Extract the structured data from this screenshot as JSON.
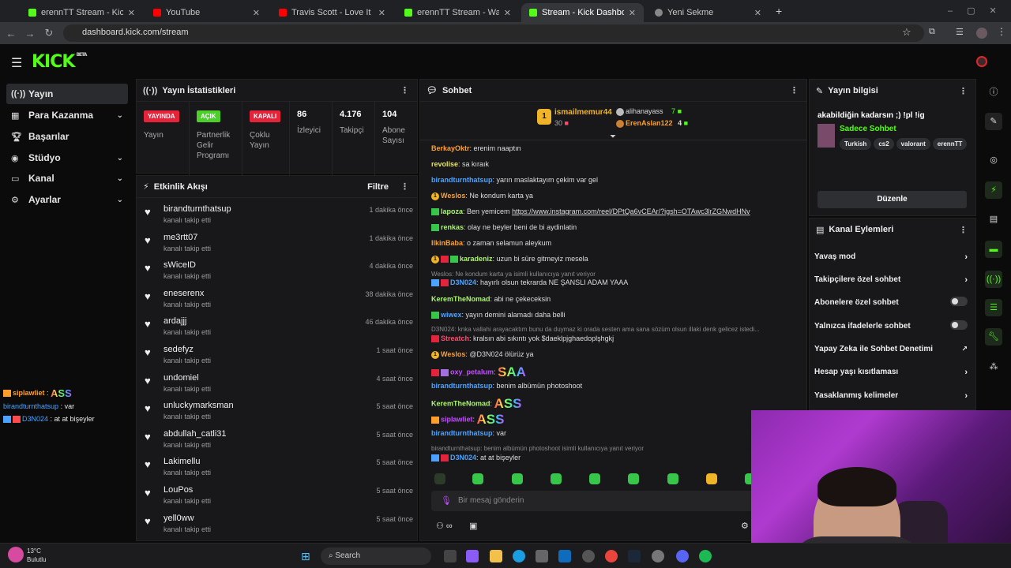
{
  "browser": {
    "tabs": [
      {
        "title": "erennTT Stream - Kick Dashboard",
        "color": "#53fc18"
      },
      {
        "title": "YouTube",
        "color": "#ff0000"
      },
      {
        "title": "Travis Scott - Love It Mane - Yo",
        "color": "#ff0000"
      },
      {
        "title": "erennTT Stream - Watch Live on",
        "color": "#53fc18"
      },
      {
        "title": "Stream - Kick Dashboard",
        "color": "#53fc18"
      },
      {
        "title": "Yeni Sekme",
        "color": "#888888"
      }
    ],
    "url": "dashboard.kick.com/stream"
  },
  "app": {
    "logo": "KICK",
    "beta": "BETA",
    "accent": "#53fc18"
  },
  "sidebar": {
    "items": [
      {
        "label": "Yayın",
        "icon": "broadcast-icon"
      },
      {
        "label": "Para Kazanma",
        "icon": "money-icon"
      },
      {
        "label": "Başarılar",
        "icon": "trophy-icon"
      },
      {
        "label": "Stüdyo",
        "icon": "studio-icon"
      },
      {
        "label": "Kanal",
        "icon": "channel-icon"
      },
      {
        "label": "Ayarlar",
        "icon": "gear-icon"
      }
    ],
    "mini_chat": [
      {
        "user": "siplawliet",
        "text": "ASS",
        "color": "#ff9f2b"
      },
      {
        "user": "birandturnthatsup",
        "text": "var",
        "color": "#4ba3ff"
      },
      {
        "user": "D3N024",
        "text": "at at bişeyler",
        "color": "#4ba3ff"
      }
    ]
  },
  "stats": {
    "title": "Yayın İstatistikleri",
    "status_badge": "YAYINDA",
    "status_label": "Yayın",
    "partner_badge": "AÇIK",
    "partner_label": "Partnerlik Gelir Programı",
    "multi_badge": "KAPALI",
    "multi_label": "Çoklu Yayın",
    "viewers": "86",
    "viewers_label": "İzleyici",
    "followers": "4.176",
    "followers_label": "Takipçi",
    "subs": "104",
    "subs_label": "Abone Sayısı"
  },
  "activity": {
    "title": "Etkinlik Akışı",
    "filter": "Filtre",
    "rows": [
      {
        "name": "birandturnthatsup",
        "sub": "kanalı takip etti",
        "time": "1 dakika önce"
      },
      {
        "name": "me3rtt07",
        "sub": "kanalı takip etti",
        "time": "1 dakika önce"
      },
      {
        "name": "sWiceID",
        "sub": "kanalı takip etti",
        "time": "4 dakika önce"
      },
      {
        "name": "eneserenx",
        "sub": "kanalı takip etti",
        "time": "38 dakika önce"
      },
      {
        "name": "ardajjj",
        "sub": "kanalı takip etti",
        "time": "46 dakika önce"
      },
      {
        "name": "sedefyz",
        "sub": "kanalı takip etti",
        "time": "1 saat önce"
      },
      {
        "name": "undomiel",
        "sub": "kanalı takip etti",
        "time": "4 saat önce"
      },
      {
        "name": "unluckymarksman",
        "sub": "kanalı takip etti",
        "time": "5 saat önce"
      },
      {
        "name": "abdullah_catli31",
        "sub": "kanalı takip etti",
        "time": "5 saat önce"
      },
      {
        "name": "Lakimellu",
        "sub": "kanalı takip etti",
        "time": "5 saat önce"
      },
      {
        "name": "LouPos",
        "sub": "kanalı takip etti",
        "time": "5 saat önce"
      },
      {
        "name": "yell0ww",
        "sub": "kanalı takip etti",
        "time": "5 saat önce"
      }
    ]
  },
  "chat": {
    "title": "Sohbet",
    "leader1": {
      "rank": "1",
      "name": "ismailmemur44",
      "count": "30"
    },
    "leader2": {
      "name": "alihanayass",
      "count": "7"
    },
    "leader3": {
      "name": "ErenAslan122",
      "count": "4"
    },
    "messages": [
      {
        "user": "BerkayOktr",
        "color": "#ff9f2b",
        "text": "erenim naaptın"
      },
      {
        "user": "revolise",
        "color": "#e6e36a",
        "text": "sa kıraık"
      },
      {
        "user": "birandturnthatsup",
        "color": "#4ba3ff",
        "text": "yarın maslaktayım çekim var gel"
      },
      {
        "user": "Weslos",
        "color": "#ff9f2b",
        "text": "Ne kondum karta ya"
      },
      {
        "user": "lapoza",
        "color": "#a9f56b",
        "text": "Ben yemicem ",
        "link": "https://www.instagram.com/reel/DPtQa6vCEAr/?igsh=OTAwc3lrZGNwdHNv"
      },
      {
        "user": "renkas",
        "color": "#a9f56b",
        "text": "olay ne beyler beni de bi aydinlatin"
      },
      {
        "user": "IlkinBaba",
        "color": "#ff9f2b",
        "text": "o zaman selamun aleykum"
      },
      {
        "user": "karadeniz",
        "color": "#a9f56b",
        "text": "uzun bi süre gitmeyiz mesela"
      },
      {
        "user": "D3N024",
        "color": "#4ba3ff",
        "text": "hayırlı olsun tekrarda NE ŞANSLI ADAM YAAA"
      },
      {
        "user": "KeremTheNomad",
        "color": "#a9f56b",
        "text": "abi ne çekeceksin"
      },
      {
        "user": "wiwex",
        "color": "#4ba3ff",
        "text": "yayın demini alamadı daha belli"
      },
      {
        "user": "Streatch",
        "color": "#ff4b6b",
        "text": "kralsın abi sıkıntı yok $daeklpjghaedoplşhgkj"
      },
      {
        "user": "Weslos",
        "color": "#ff9f2b",
        "text": "@D3N024 ölürüz ya"
      },
      {
        "user": "oxy_petalum",
        "color": "#c34bff",
        "text": "SAA"
      },
      {
        "user": "birandturnthatsup",
        "color": "#4ba3ff",
        "text": "benim albümün photoshoot"
      },
      {
        "user": "KeremTheNomad",
        "color": "#a9f56b",
        "text": "ASS"
      },
      {
        "user": "siplawliet",
        "color": "#c34bff",
        "text": "ASS"
      },
      {
        "user": "birandturnthatsup",
        "color": "#4ba3ff",
        "text": "var"
      },
      {
        "user": "D3N024",
        "color": "#4ba3ff",
        "text": "at at bişeyler"
      }
    ],
    "reply1": "Weslos: Ne kondum karta ya isimli kullanıcıya yanıt veriyor",
    "reply2": "D3N024: knka vallahi arayacaktım bunu da duymaz ki orada sesten ama sana sözüm olsun illaki denk gelicez istedi...",
    "reply3": "birandturnthatsup: benim albümün photoshoot isimli kullanıcıya yanıt veriyor",
    "input_placeholder": "Bir mesaj gönderin"
  },
  "info": {
    "title": "Yayın bilgisi",
    "stream_title": "akabildiğin kadarsın ;) !pl !ig",
    "category": "Sadece Sohbet",
    "tags": [
      "Turkish",
      "cs2",
      "valorant",
      "erennTT"
    ],
    "edit_button": "Düzenle"
  },
  "actions": {
    "title": "Kanal Eylemleri",
    "items": [
      {
        "label": "Yavaş mod",
        "kind": "arrow"
      },
      {
        "label": "Takipçilere özel sohbet",
        "kind": "arrow"
      },
      {
        "label": "Abonelere özel sohbet",
        "kind": "toggle"
      },
      {
        "label": "Yalnızca ifadelerle sohbet",
        "kind": "toggle"
      },
      {
        "label": "Yapay Zeka ile Sohbet Denetimi",
        "kind": "external"
      },
      {
        "label": "Hesap yaşı kısıtlaması",
        "kind": "arrow"
      },
      {
        "label": "Yasaklanmış kelimeler",
        "kind": "arrow"
      }
    ]
  },
  "taskbar": {
    "weather_temp": "13°C",
    "weather_desc": "Bulutlu",
    "search": "Search"
  }
}
